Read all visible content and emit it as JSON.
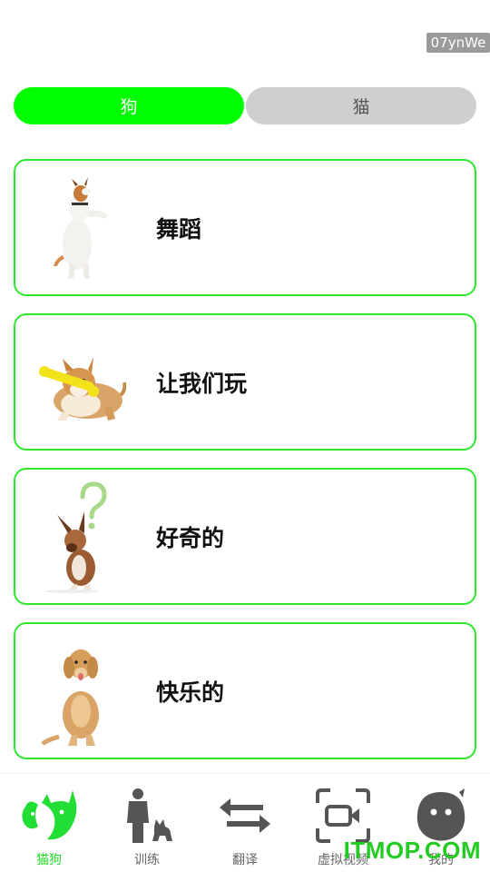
{
  "badge": "07ynWe",
  "tabs": [
    {
      "label": "狗",
      "active": true
    },
    {
      "label": "猫",
      "active": false
    }
  ],
  "cards": [
    {
      "label": "舞蹈",
      "image": "dancing-dog"
    },
    {
      "label": "让我们玩",
      "image": "corgi-with-toy"
    },
    {
      "label": "好奇的",
      "image": "curious-dog-question-mark"
    },
    {
      "label": "快乐的",
      "image": "happy-golden-retriever"
    }
  ],
  "nav": [
    {
      "label": "猫狗",
      "icon": "cat-dog-icon",
      "active": true
    },
    {
      "label": "训练",
      "icon": "person-with-dog-icon",
      "active": false
    },
    {
      "label": "翻译",
      "icon": "swap-arrows-icon",
      "active": false
    },
    {
      "label": "虚拟视频",
      "icon": "video-camera-icon",
      "active": false
    },
    {
      "label": "我的",
      "icon": "chat-face-icon",
      "active": false
    }
  ],
  "watermark": "ITMOP.COM",
  "colors": {
    "accent": "#00ff00",
    "border": "#2ee82e",
    "inactive_tab": "#cfcfcf"
  }
}
